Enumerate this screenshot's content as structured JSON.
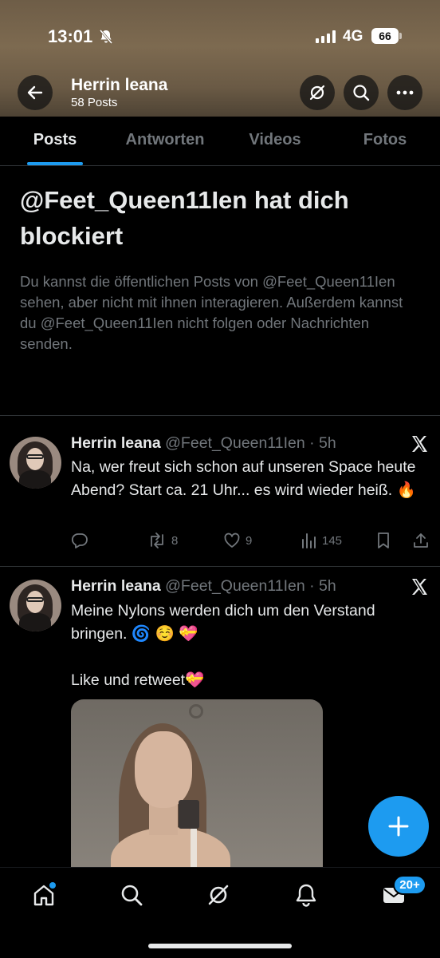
{
  "status_bar": {
    "time": "13:01",
    "network": "4G",
    "battery": "66"
  },
  "header": {
    "name": "Herrin leana",
    "post_count": "58 Posts"
  },
  "tabs": [
    {
      "label": "Posts",
      "active": true
    },
    {
      "label": "Antworten",
      "active": false
    },
    {
      "label": "Videos",
      "active": false
    },
    {
      "label": "Fotos",
      "active": false
    }
  ],
  "blocked_notice": {
    "title": "@Feet_Queen11Ien hat dich blockiert",
    "text": "Du kannst die öffentlichen Posts von @Feet_Queen11Ien sehen, aber nicht mit ihnen interagieren. Außerdem kannst du @Feet_Queen11Ien nicht folgen oder Nachrichten senden."
  },
  "posts": [
    {
      "name": "Herrin leana",
      "meta": "@Feet_Queen11Ien · 5h",
      "text": "Na, wer freut sich schon auf unseren Space heute Abend? Start ca. 21 Uhr... es wird wieder heiß. 🔥",
      "actions": {
        "replies": "",
        "reposts": "8",
        "likes": "9",
        "views": "145"
      }
    },
    {
      "name": "Herrin leana",
      "meta": "@Feet_Queen11Ien · 5h",
      "text": "Meine Nylons werden dich um den Verstand bringen. 🌀 ☺️ 💝\n\nLike und retweet💝"
    }
  ],
  "bottom_nav": {
    "notifications_badge": "20+"
  },
  "colors": {
    "accent": "#1d9bf0",
    "background": "#000000",
    "muted": "#71767b"
  },
  "icons": [
    "back-arrow-icon",
    "grok-icon",
    "search-icon",
    "more-icon",
    "x-logo-icon",
    "reply-icon",
    "repost-icon",
    "like-icon",
    "views-icon",
    "bookmark-icon",
    "share-icon",
    "compose-plus-icon",
    "home-icon",
    "notifications-icon",
    "messages-icon"
  ]
}
